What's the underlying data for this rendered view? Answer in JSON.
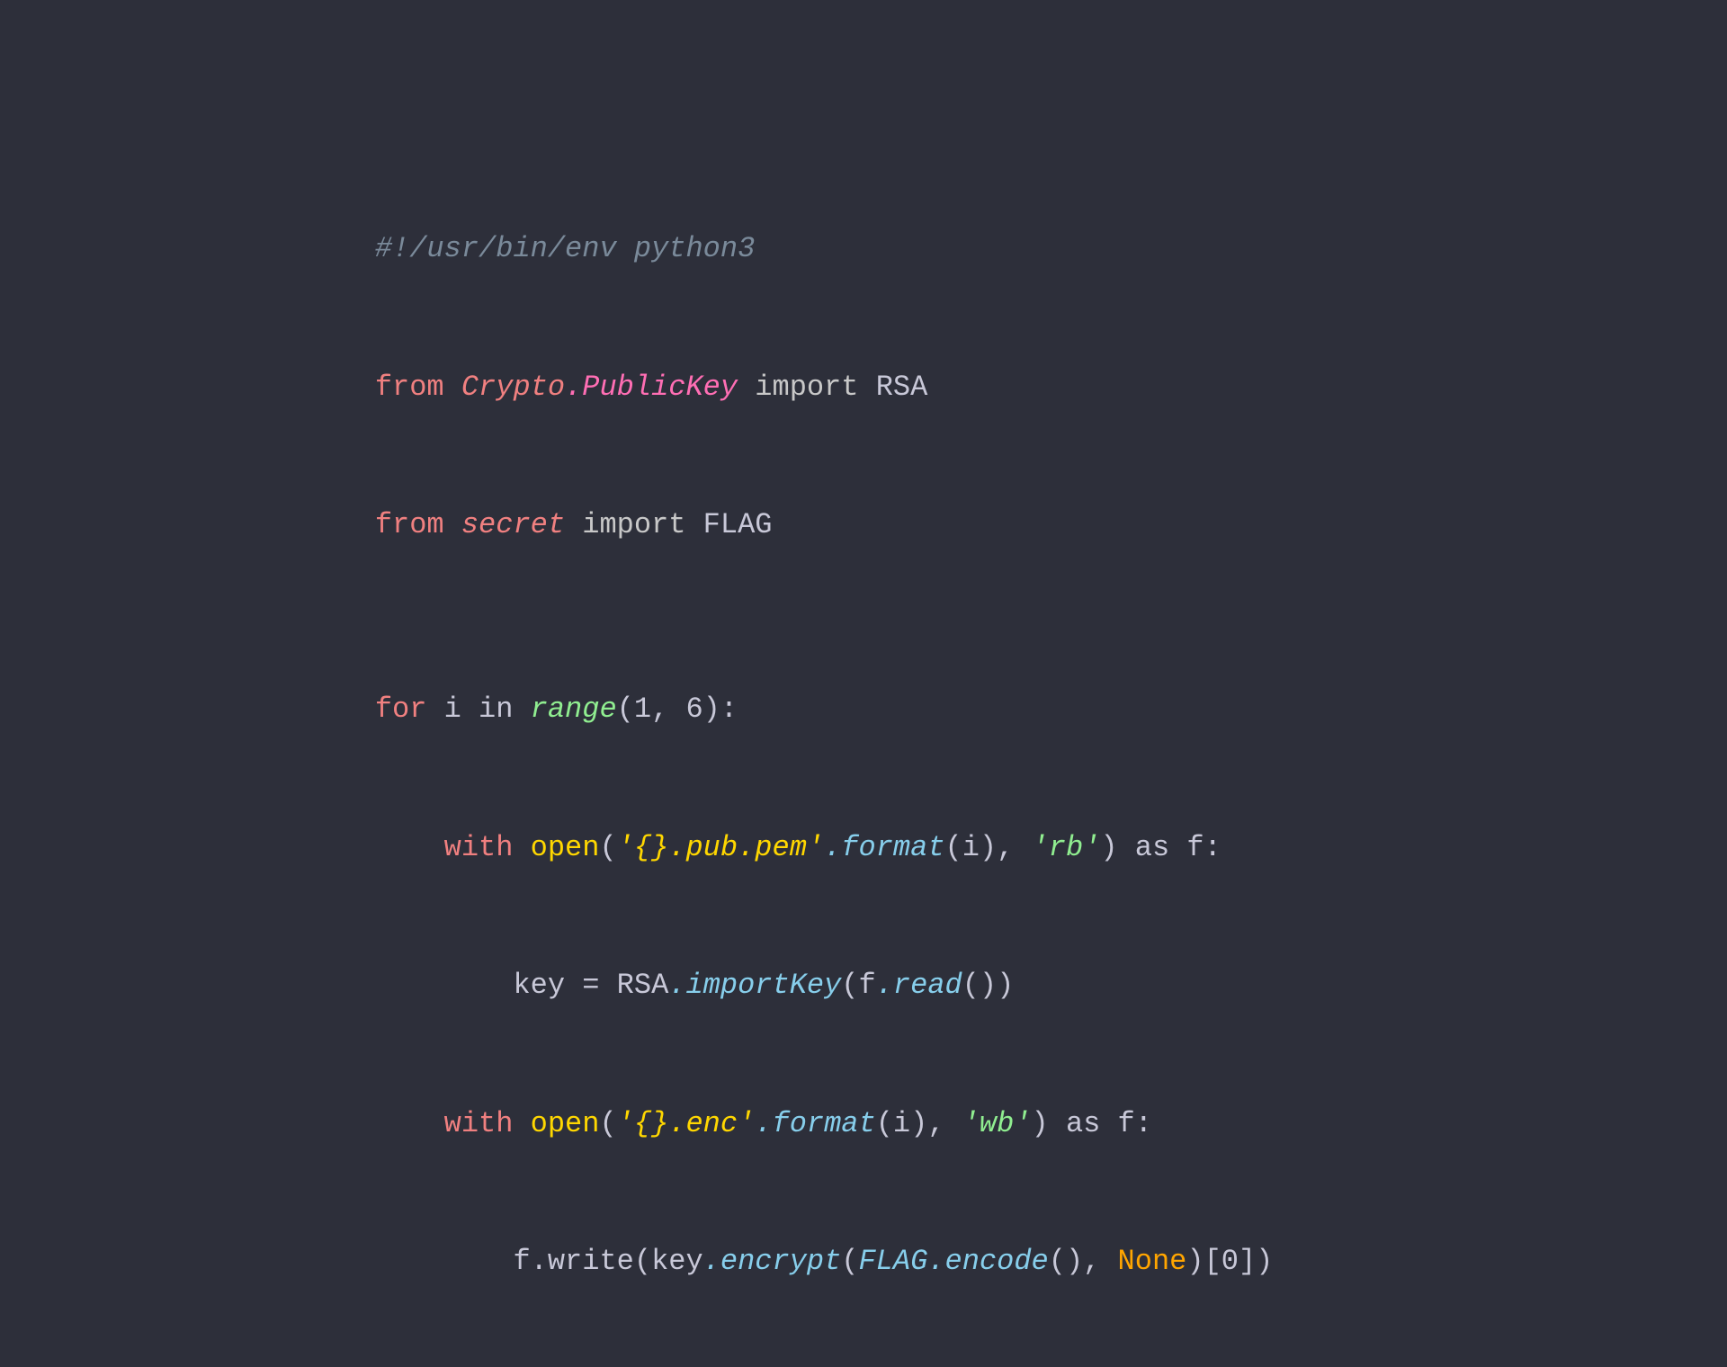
{
  "background": "#2d2f3a",
  "code": {
    "line1": "#!/usr/bin/env python3",
    "line2_from": "from",
    "line2_module": "Crypto.PublicKey",
    "line2_import": "import",
    "line2_class": "RSA",
    "line3_from": "from",
    "line3_module": "secret",
    "line3_import": "import",
    "line3_class": "FLAG",
    "line5_for": "for",
    "line5_var": "i",
    "line5_in": "in",
    "line5_range": "range",
    "line5_args": "(1, 6):",
    "line6_with": "with",
    "line6_open": "open",
    "line6_str1": "'{}.pub.pem'",
    "line6_format": ".format",
    "line6_args": "(i),",
    "line6_mode": "'rb'",
    "line6_as": "as",
    "line6_f": "f:",
    "line7_key": "key",
    "line7_eq": "=",
    "line7_rsa": "RSA",
    "line7_method": ".importKey",
    "line7_fread": "(f.read())",
    "line8_with": "with",
    "line8_open": "open",
    "line8_str": "'{}.enc'",
    "line8_format": ".format",
    "line8_args": "(i),",
    "line8_mode": "'wb'",
    "line8_as": "as",
    "line8_f": "f:",
    "line9_fwrite": "f.write",
    "line9_keyenc": "(key.encrypt",
    "line9_flagenc": "(FLAG.encode",
    "line9_none": "(), None",
    "line9_end": ")[0])"
  }
}
